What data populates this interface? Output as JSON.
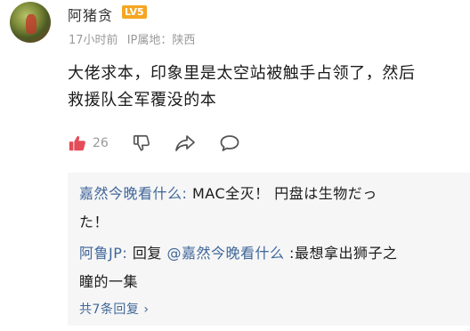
{
  "author": {
    "name": "阿猪贪",
    "level_badge": "LV5"
  },
  "meta": {
    "time": "17小时前",
    "location": "IP属地：陕西"
  },
  "comment": {
    "line1": "大佬求本，印象里是太空站被触手占领了，然后",
    "line2": "救援队全军覆没的本"
  },
  "actions": {
    "like_count": "26"
  },
  "replies": [
    {
      "author": "嘉然今晚看什么:",
      "line1": " MAC全灭！ 円盘は生物だっ",
      "line2": "た！"
    },
    {
      "author": "阿鲁JP:",
      "line1_pre": " 回复 ",
      "mention": "@嘉然今晚看什么",
      "line1_post": " :最想拿出狮子之",
      "line2": "瞳的一集"
    }
  ],
  "more_replies_label": "共7条回复 ›"
}
